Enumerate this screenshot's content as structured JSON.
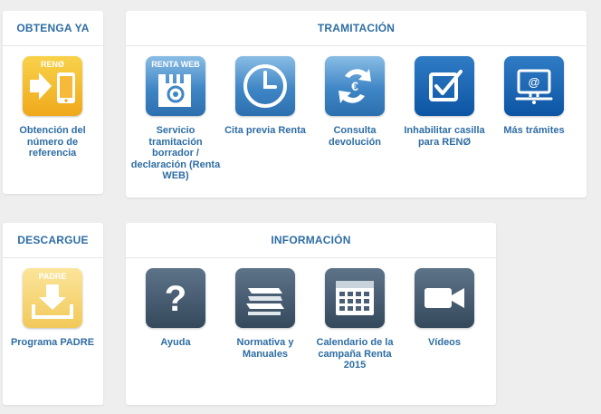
{
  "panels": {
    "obtenga": {
      "title": "OBTENGA YA"
    },
    "tramitacion": {
      "title": "TRAMITACIÓN"
    },
    "descargue": {
      "title": "DESCARGUE"
    },
    "informacion": {
      "title": "INFORMACIÓN"
    }
  },
  "obtenga": {
    "items": [
      {
        "label": "Obtención del número de referencia",
        "badge": "RENØ",
        "icon": "reno-transfer-icon"
      }
    ]
  },
  "tramitacion": {
    "items": [
      {
        "label": "Servicio tramitación borrador / declaración (Renta WEB)",
        "badge": "RENTA WEB",
        "icon": "renta-web-icon"
      },
      {
        "label": "Cita previa Renta",
        "icon": "clock-icon"
      },
      {
        "label": "Consulta devolución",
        "icon": "euro-refund-icon"
      },
      {
        "label": "Inhabilitar casilla para RENØ",
        "icon": "checkbox-icon"
      },
      {
        "label": "Más trámites",
        "icon": "computer-at-icon"
      }
    ]
  },
  "descargue": {
    "items": [
      {
        "label": "Programa PADRE",
        "badge": "PADRE",
        "icon": "download-icon"
      }
    ]
  },
  "informacion": {
    "items": [
      {
        "label": "Ayuda",
        "icon": "question-icon"
      },
      {
        "label": "Normativa y Manuales",
        "icon": "books-icon"
      },
      {
        "label": "Calendario de la campaña Renta 2015",
        "icon": "calendar-icon"
      },
      {
        "label": "Vídeos",
        "icon": "video-camera-icon"
      }
    ]
  },
  "colors": {
    "accent": "#2e6da4",
    "background": "#eeeeee",
    "panel": "#ffffff"
  }
}
